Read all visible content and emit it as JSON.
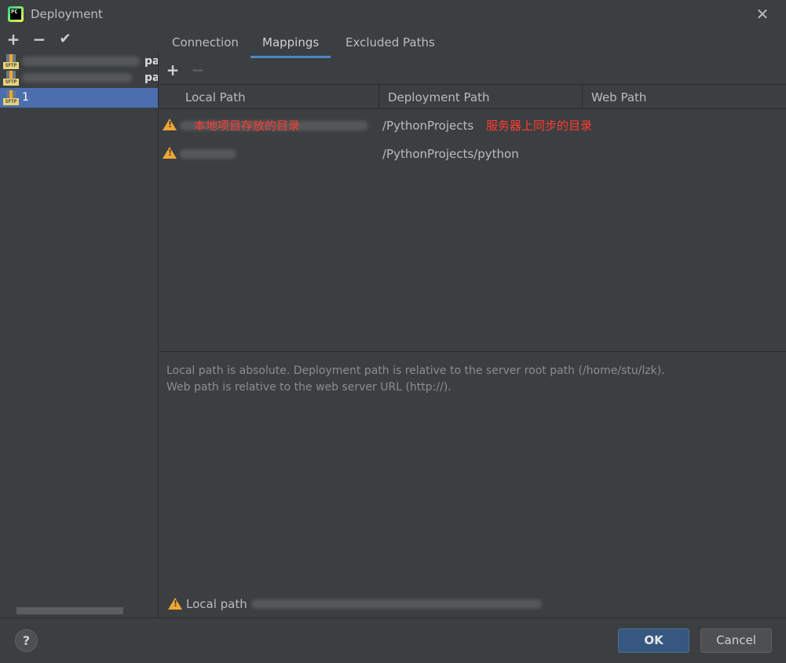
{
  "window": {
    "title": "Deployment",
    "logo_text": "PC"
  },
  "left_toolbar": {
    "add": "+",
    "remove": "−",
    "apply": "✔"
  },
  "servers": [
    {
      "label": "",
      "suffix": "pa",
      "icon_label": "SFTP"
    },
    {
      "label": "",
      "suffix": "pa",
      "icon_label": "SFTP"
    },
    {
      "label": "1",
      "suffix": "",
      "icon_label": "SFTP",
      "selected": true
    }
  ],
  "tabs": [
    {
      "label": "Connection"
    },
    {
      "label": "Mappings",
      "active": true
    },
    {
      "label": "Excluded Paths"
    }
  ],
  "mapping_toolbar": {
    "add": "+",
    "remove": "−"
  },
  "table": {
    "columns": [
      "Local Path",
      "Deployment Path",
      "Web Path"
    ],
    "rows": [
      {
        "local_path": "",
        "deployment_path": "/PythonProjects",
        "web_path": ""
      },
      {
        "local_path": "",
        "deployment_path": "/PythonProjects/python",
        "web_path": ""
      }
    ]
  },
  "annotations": {
    "local": "本地项目存放的目录",
    "remote": "服务器上同步的目录"
  },
  "help_text": {
    "line1": "Local path is absolute. Deployment path is relative to the server root path (/home/stu/lzk).",
    "line2": "Web path is relative to the web server URL (http://)."
  },
  "status": {
    "label": "Local path"
  },
  "footer": {
    "help": "?",
    "ok": "OK",
    "cancel": "Cancel"
  },
  "colors": {
    "accent": "#4a88c7",
    "selection": "#4b6eaf",
    "warning": "#f0a732",
    "annotation": "#ff3b30"
  }
}
